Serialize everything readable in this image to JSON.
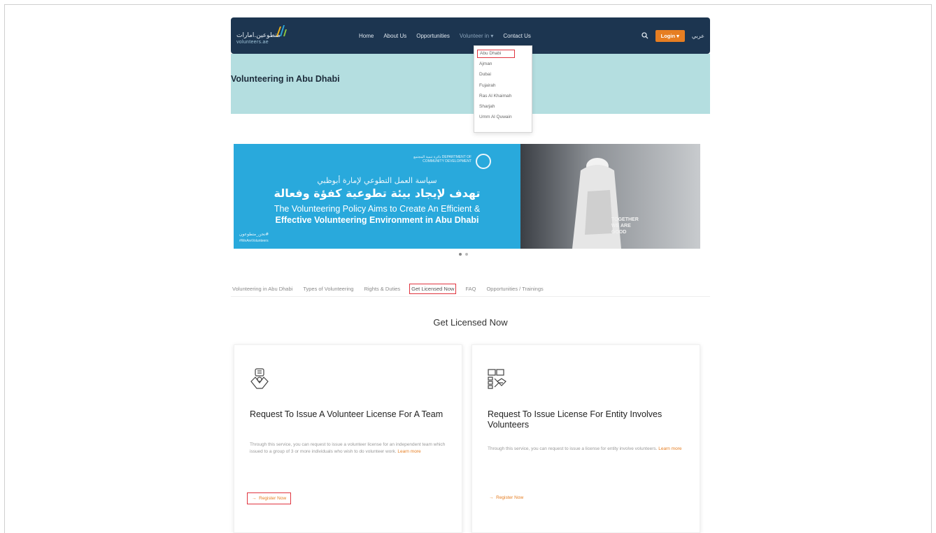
{
  "header": {
    "logo_ar": "متطوعين.امارات",
    "logo_en": "volunteers.ae",
    "nav": [
      "Home",
      "About Us",
      "Opportunities",
      "Volunteer in ▾",
      "Contact Us"
    ],
    "login_label": "Login ▾",
    "lang_label": "عربي"
  },
  "dropdown": [
    "Abu Dhabi",
    "Ajman",
    "Dubai",
    "Fujairah",
    "Ras Al Khaimah",
    "Sharjah",
    "Umm Al Quwain"
  ],
  "hero": {
    "title": "Volunteering in Abu Dhabi"
  },
  "banner": {
    "org": "دائرة تنمية المجتمع DEPARTMENT OF COMMUNITY DEVELOPMENT",
    "ar_line1": "سياسة العمل التطوعي لإمارة أبوظبي",
    "ar_line2": "تهدف لإيجاد بيئة تطوعية كفؤة وفعالة",
    "en_line1": "The Volunteering Policy Aims to Create An Efficient &",
    "en_line2": "Effective Volunteering Environment in Abu Dhabi",
    "hashtag_ar": "نحن_متطوعون#",
    "hashtag_en": "#WeAreVolunteers",
    "together": [
      "TOGETHER",
      "WE ARE",
      "GOOD"
    ]
  },
  "tabs": [
    "Volunteering in Abu Dhabi",
    "Types of Volunteering",
    "Rights & Duties",
    "Get Licensed Now",
    "FAQ",
    "Opportunities / Trainings"
  ],
  "section_title": "Get Licensed Now",
  "cards": [
    {
      "icon": "team-license-icon",
      "title": "Request To Issue A Volunteer License For A Team",
      "desc": "Through this service, you can request to issue a volunteer license for an independent team which issued to a group of 3 or more individuals who wish to do volunteer work.",
      "more": "Learn more",
      "link": "Register Now"
    },
    {
      "icon": "entity-license-icon",
      "title": "Request To Issue License For Entity Involves Volunteers",
      "desc": "Through this service, you can request to issue a license for entity involve volunteers.",
      "more": "Learn more",
      "link": "Register Now"
    }
  ],
  "colors": {
    "navy": "#1c3550",
    "hero_bg": "#b4dee0",
    "banner_blue": "#29a9dc",
    "accent": "#e67e22",
    "highlight": "#e0343f"
  }
}
